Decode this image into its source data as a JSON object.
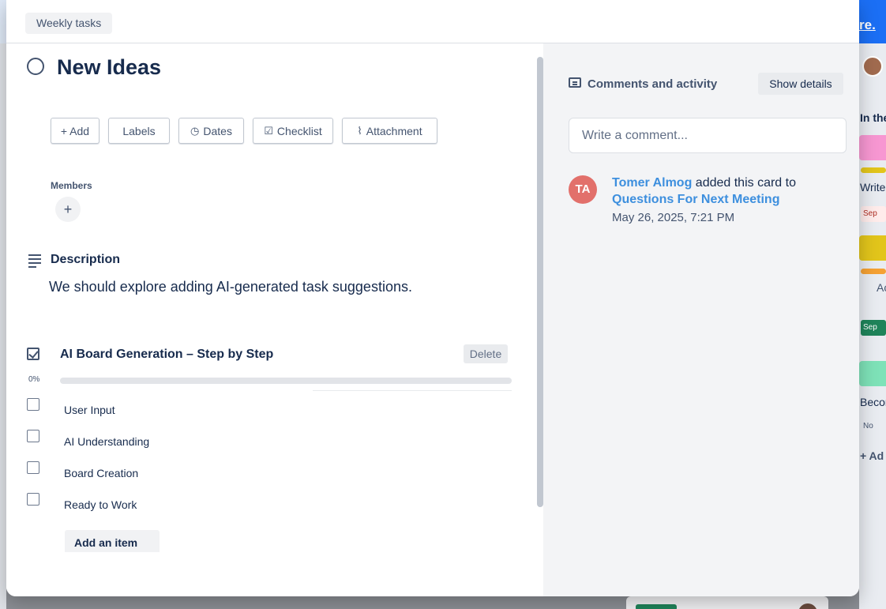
{
  "background": {
    "link_fragment": "re.",
    "right_column": {
      "header": "In the",
      "card1_text": "Write",
      "card1_chip": "Sep",
      "card2_text": "Ac",
      "card2_chip": "Sep",
      "card3_text": "Becon",
      "card3_chip": "No",
      "add_card": "+ Ad"
    }
  },
  "header": {
    "list_name": "Weekly tasks"
  },
  "card": {
    "title": "New Ideas",
    "actions": [
      {
        "label": "+ Add",
        "icon": "plus-icon"
      },
      {
        "label": "Labels",
        "icon": "label-icon"
      },
      {
        "label": "Dates",
        "icon": "clock-icon"
      },
      {
        "label": "Checklist",
        "icon": "checklist-icon"
      },
      {
        "label": "Attachment",
        "icon": "paperclip-icon"
      }
    ],
    "members_label": "Members",
    "member_add_symbol": "+",
    "description_label": "Description",
    "description_text": "We should explore adding AI-generated task suggestions.",
    "checklist": {
      "title": "AI Board Generation – Step by Step",
      "delete_label": "Delete",
      "percent_label": "0%",
      "progress": 0,
      "items": [
        {
          "text": "User Input",
          "checked": false
        },
        {
          "text": "AI Understanding",
          "checked": false
        },
        {
          "text": "Board Creation",
          "checked": false
        },
        {
          "text": "Ready to Work",
          "checked": false
        }
      ],
      "add_item_label": "Add an item"
    }
  },
  "activity": {
    "title": "Comments and activity",
    "show_details_label": "Show details",
    "comment_placeholder": "Write a comment...",
    "entries": [
      {
        "initials": "TA",
        "user": "Tomer Almog",
        "action": " added this card to",
        "target": "Questions For Next Meeting",
        "timestamp": "May 26, 2025, 7:21 PM"
      }
    ]
  },
  "colors": {
    "accent_blue": "#3d8fde",
    "avatar_red": "#e2706b",
    "progress_track": "#e2e4e8"
  }
}
